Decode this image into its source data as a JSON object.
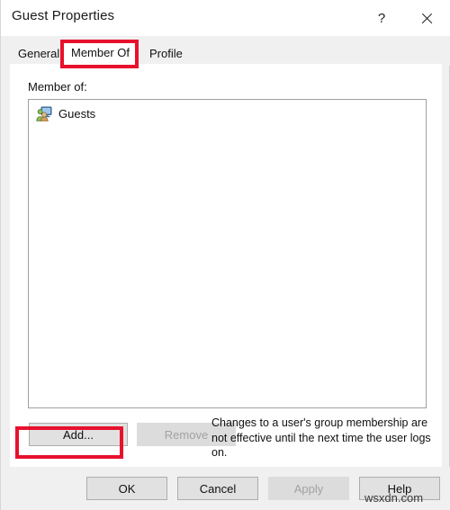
{
  "window": {
    "title": "Guest Properties",
    "help_button": "?",
    "close_button": "close-icon"
  },
  "tabs": [
    {
      "label": "General",
      "active": false
    },
    {
      "label": "Member Of",
      "active": true
    },
    {
      "label": "Profile",
      "active": false
    }
  ],
  "main": {
    "member_of_label": "Member of:",
    "groups": [
      {
        "name": "Guests",
        "icon": "group-icon"
      }
    ],
    "add_button": "Add...",
    "remove_button": "Remove",
    "remove_enabled": false,
    "hint": "Changes to a user's group membership are not effective until the next time the user logs on."
  },
  "footer": {
    "ok": "OK",
    "cancel": "Cancel",
    "apply": "Apply",
    "apply_enabled": false,
    "help": "Help"
  },
  "watermark": "wsxdn.com",
  "colors": {
    "annotation": "#e8112d",
    "window_bg": "#f0f0f0",
    "panel_bg": "#ffffff",
    "button_bg": "#e1e1e1",
    "disabled_text": "#a2a2a2"
  }
}
